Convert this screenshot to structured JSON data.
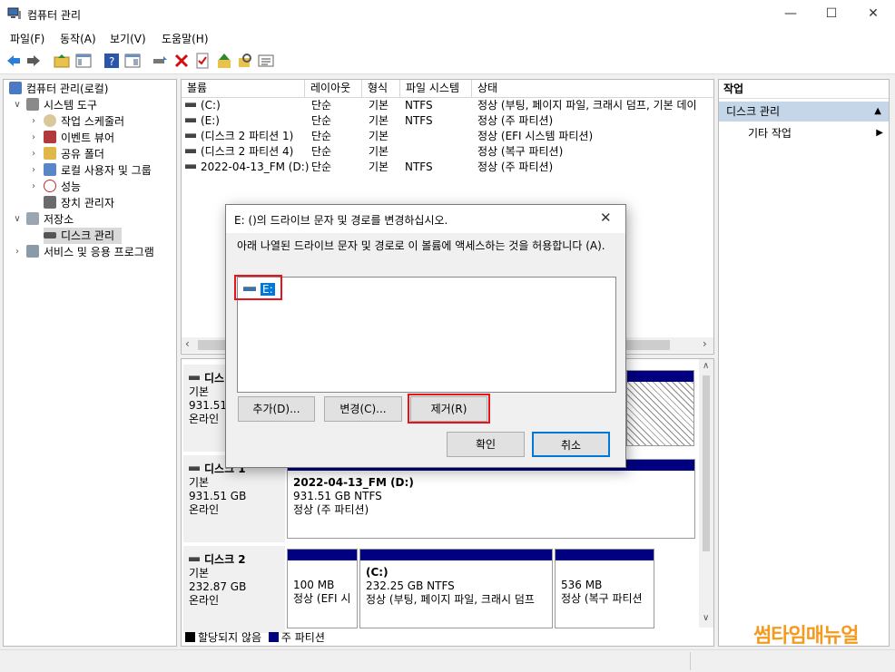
{
  "window": {
    "title": "컴퓨터 관리",
    "min": "—",
    "max": "☐",
    "close": "✕"
  },
  "menu": [
    "파일(F)",
    "동작(A)",
    "보기(V)",
    "도움말(H)"
  ],
  "toolbar": [
    "back-arrow-icon",
    "forward-arrow-icon",
    "up-folder-icon",
    "show-pane-icon",
    "help-icon",
    "properties-pane-icon",
    "connect-drive-icon",
    "delete-x-icon",
    "check-icon",
    "up-arrow-icon",
    "find-icon",
    "list-icon"
  ],
  "tree": {
    "root": "컴퓨터 관리(로컬)",
    "system_tools": "시스템 도구",
    "task_scheduler": "작업 스케줄러",
    "event_viewer": "이벤트 뷰어",
    "shared_folders": "공유 폴더",
    "local_users": "로컬 사용자 및 그룹",
    "performance": "성능",
    "device_manager": "장치 관리자",
    "storage": "저장소",
    "disk_management": "디스크 관리",
    "services": "서비스 및 응용 프로그램"
  },
  "volumes": {
    "headers": [
      "볼륨",
      "레이아웃",
      "형식",
      "파일 시스템",
      "상태"
    ],
    "rows": [
      [
        "(C:)",
        "단순",
        "기본",
        "NTFS",
        "정상 (부팅, 페이지 파일, 크래시 덤프, 기본 데이"
      ],
      [
        "(E:)",
        "단순",
        "기본",
        "NTFS",
        "정상 (주 파티션)"
      ],
      [
        "(디스크 2 파티션 1)",
        "단순",
        "기본",
        "",
        "정상 (EFI 시스템 파티션)"
      ],
      [
        "(디스크 2 파티션 4)",
        "단순",
        "기본",
        "",
        "정상 (복구 파티션)"
      ],
      [
        "2022-04-13_FM (D:)",
        "단순",
        "기본",
        "NTFS",
        "정상 (주 파티션)"
      ]
    ]
  },
  "disks": {
    "disk0": {
      "name": "디스",
      "type": "기본",
      "size": "931.51",
      "status": "온라인"
    },
    "disk1": {
      "name": "디스크 1",
      "type": "기본",
      "size": "931.51 GB",
      "status": "온라인",
      "part_name": "2022-04-13_FM  (D:)",
      "part_size": "931.51 GB NTFS",
      "part_status": "정상 (주 파티션)"
    },
    "disk2": {
      "name": "디스크 2",
      "type": "기본",
      "size": "232.87 GB",
      "status": "온라인",
      "p1_size": "100 MB",
      "p1_status": "정상 (EFI 시",
      "p2_name": "(C:)",
      "p2_size": "232.25 GB NTFS",
      "p2_status": "정상 (부팅, 페이지 파일, 크래시 덤프",
      "p3_size": "536 MB",
      "p3_status": "정상 (복구 파티션"
    }
  },
  "legend": {
    "unallocated": "할당되지 않음",
    "primary": "주 파티션"
  },
  "actions": {
    "header": "작업",
    "section": "디스크 관리",
    "more": "기타 작업"
  },
  "dialog": {
    "title": "E: ()의 드라이브 문자 및 경로를 변경하십시오.",
    "description": "아래 나열된 드라이브 문자 및 경로로 이 볼륨에 액세스하는 것을 허용합니다 (A).",
    "list_item": "E:",
    "add": "추가(D)...",
    "change": "변경(C)...",
    "remove": "제거(R)",
    "ok": "확인",
    "cancel": "취소"
  },
  "watermark": "썸타임매뉴얼",
  "colors": {
    "primary_partition": "#000080",
    "highlight": "#e8141a",
    "selection": "#0078d7",
    "watermark": "#f39a1f"
  }
}
